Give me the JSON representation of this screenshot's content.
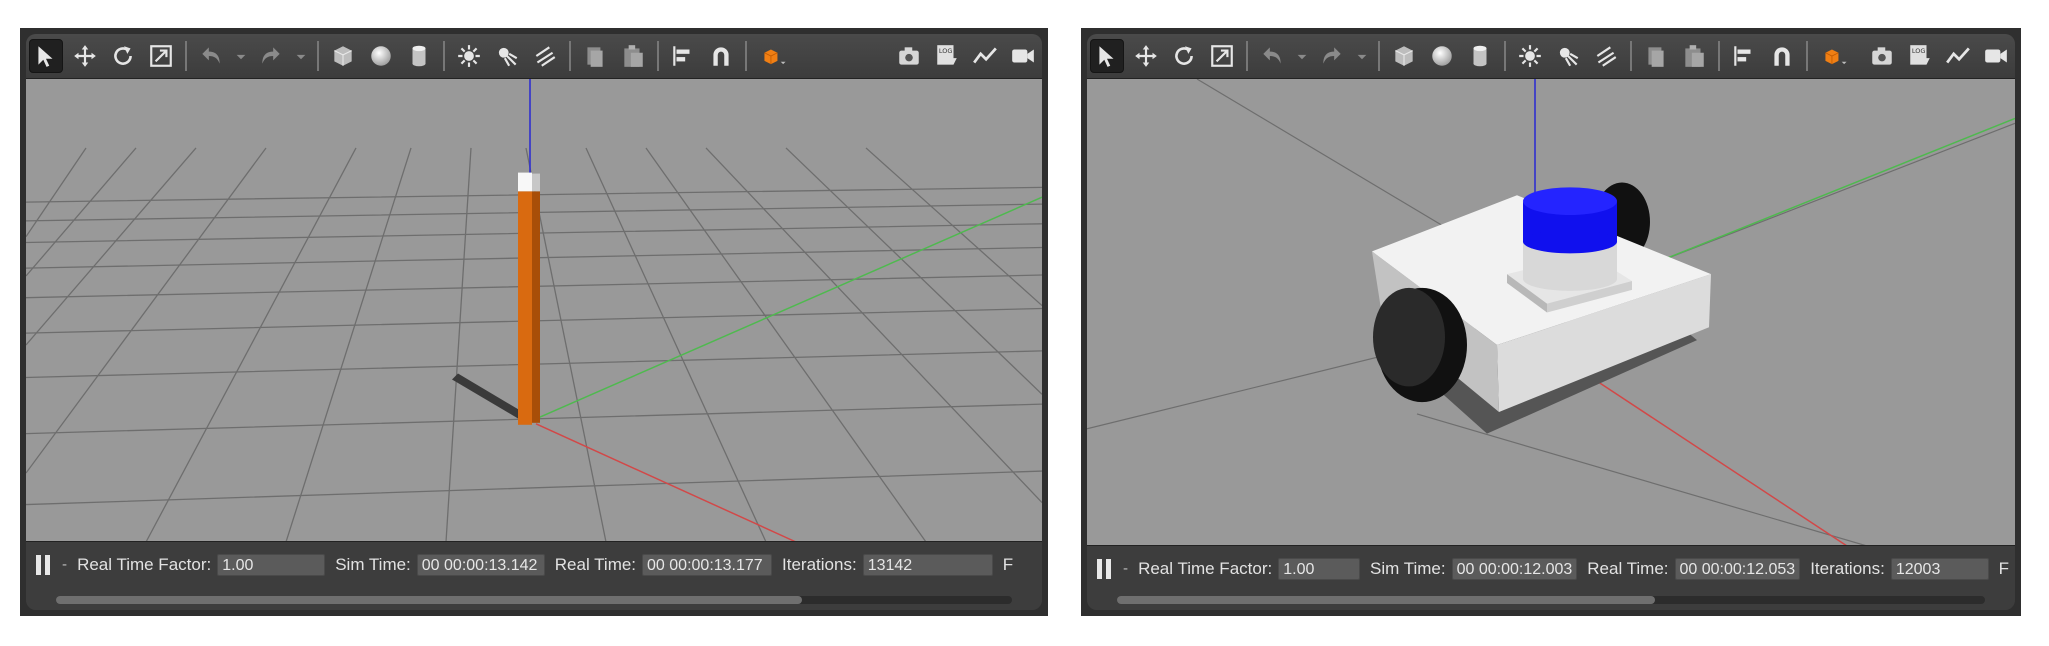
{
  "left_window": {
    "status": {
      "real_time_factor_label": "Real Time Factor:",
      "real_time_factor": "1.00",
      "sim_time_label": "Sim Time:",
      "sim_time": "00 00:00:13.142",
      "real_time_label": "Real Time:",
      "real_time": "00 00:00:13.177",
      "iterations_label": "Iterations:",
      "iterations": "13142",
      "truncated": "F"
    },
    "scrollbar_fraction": 0.78
  },
  "right_window": {
    "status": {
      "real_time_factor_label": "Real Time Factor:",
      "real_time_factor": "1.00",
      "sim_time_label": "Sim Time:",
      "sim_time": "00 00:00:12.003",
      "real_time_label": "Real Time:",
      "real_time": "00 00:00:12.053",
      "iterations_label": "Iterations:",
      "iterations": "12003",
      "truncated": "F"
    },
    "scrollbar_fraction": 0.62
  },
  "colors": {
    "background": "#999999",
    "grid": "#6e6e6e",
    "x_axis": "#d24848",
    "y_axis": "#4fb94f",
    "z_axis": "#2f2fcf",
    "pillar": "#d96a10",
    "robot_body": "#f2f2f2",
    "lidar": "#1010ee",
    "wheel": "#111111"
  },
  "toolbar_icons": [
    "select-arrow-icon",
    "translate-icon",
    "rotate-icon",
    "scale-icon",
    "undo-icon",
    "undo-dropdown-icon",
    "redo-icon",
    "redo-dropdown-icon",
    "box-shape-icon",
    "sphere-shape-icon",
    "cylinder-shape-icon",
    "point-light-icon",
    "spot-light-icon",
    "directional-light-icon",
    "copy-icon",
    "paste-icon",
    "align-icon",
    "snap-icon",
    "change-view-icon",
    "screenshot-icon",
    "log-icon",
    "plot-icon",
    "video-record-icon"
  ]
}
